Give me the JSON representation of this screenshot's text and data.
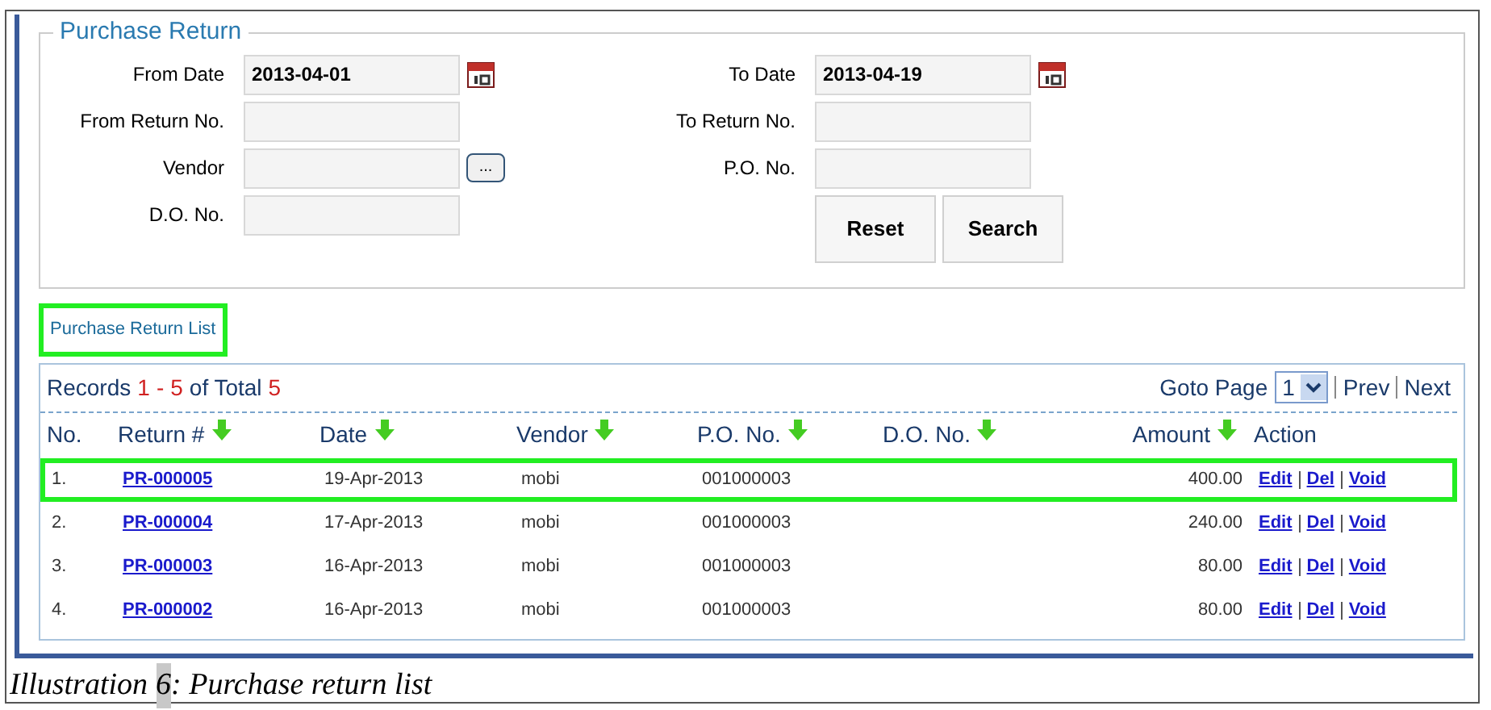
{
  "form": {
    "title": "Purchase Return",
    "fields": [
      {
        "label": "From Date",
        "value": "2013-04-01",
        "kind": "date"
      },
      {
        "label": "To Date",
        "value": "2013-04-19",
        "kind": "date"
      },
      {
        "label": "From Return No.",
        "kind": "text"
      },
      {
        "label": "To Return No.",
        "kind": "text"
      },
      {
        "label": "Vendor",
        "kind": "lookup",
        "button": "..."
      },
      {
        "label": "P.O. No.",
        "kind": "text"
      },
      {
        "label": "D.O. No.",
        "kind": "text"
      }
    ],
    "buttons": [
      "Reset",
      "Search"
    ]
  },
  "list_link": {
    "label": "Purchase Return List",
    "highlighted": true
  },
  "records": {
    "label": "Records",
    "from": "1",
    "dash": "-",
    "to": "5",
    "of": "of Total",
    "total": "5"
  },
  "pager": {
    "label": "Goto Page",
    "page": "1",
    "links": [
      "Prev",
      "Next"
    ]
  },
  "columns": [
    {
      "label": "No.",
      "sortable": false
    },
    {
      "label": "Return #",
      "sortable": true
    },
    {
      "label": "Date",
      "sortable": true
    },
    {
      "label": "Vendor",
      "sortable": true
    },
    {
      "label": "P.O. No.",
      "sortable": true
    },
    {
      "label": "D.O. No.",
      "sortable": true
    },
    {
      "label": "Amount",
      "sortable": true
    },
    {
      "label": "Action",
      "sortable": false
    }
  ],
  "rows": [
    {
      "no": "1.",
      "return_no": "PR-000005",
      "date": "19-Apr-2013",
      "vendor": "mobi",
      "po": "001000003",
      "amount": "400.00",
      "actions": [
        "Edit",
        "Del",
        "Void"
      ],
      "highlighted": true
    },
    {
      "no": "2.",
      "return_no": "PR-000004",
      "date": "17-Apr-2013",
      "vendor": "mobi",
      "po": "001000003",
      "amount": "240.00",
      "actions": [
        "Edit",
        "Del",
        "Void"
      ],
      "highlighted": false
    },
    {
      "no": "3.",
      "return_no": "PR-000003",
      "date": "16-Apr-2013",
      "vendor": "mobi",
      "po": "001000003",
      "amount": "80.00",
      "actions": [
        "Edit",
        "Del",
        "Void"
      ],
      "highlighted": false
    },
    {
      "no": "4.",
      "return_no": "PR-000002",
      "date": "16-Apr-2013",
      "vendor": "mobi",
      "po": "001000003",
      "amount": "80.00",
      "actions": [
        "Edit",
        "Del",
        "Void"
      ],
      "highlighted": false
    }
  ],
  "caption": {
    "label": "Illustration",
    "number": "6",
    "text": ": Purchase return list"
  }
}
